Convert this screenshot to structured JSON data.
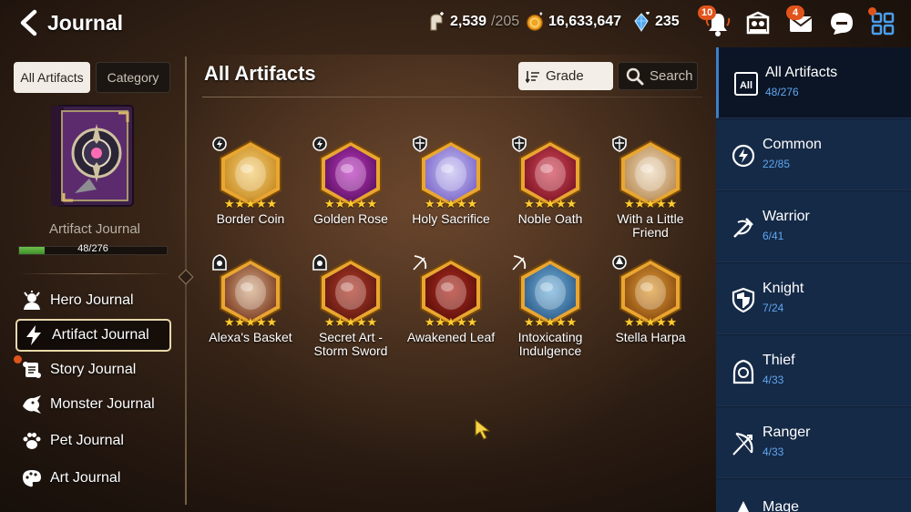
{
  "header": {
    "title": "Journal",
    "currencies": [
      {
        "icon": "stamina-icon",
        "value": "2,539",
        "sub": "/205"
      },
      {
        "icon": "gold-icon",
        "value": "16,633,647",
        "sub": ""
      },
      {
        "icon": "crystal-icon",
        "value": "235",
        "sub": ""
      }
    ],
    "notifications_badge": "10",
    "mail_badge": "4"
  },
  "left": {
    "tabs": {
      "active": "All Artifacts",
      "other": "Category"
    },
    "book_title": "Artifact Journal",
    "progress_text": "48/276",
    "progress_fraction": 0.174,
    "nav": [
      {
        "label": "Hero Journal",
        "icon": "hero-icon"
      },
      {
        "label": "Artifact Journal",
        "icon": "lightning-icon"
      },
      {
        "label": "Story Journal",
        "icon": "scroll-icon"
      },
      {
        "label": "Monster Journal",
        "icon": "dragon-icon"
      },
      {
        "label": "Pet Journal",
        "icon": "paw-icon"
      },
      {
        "label": "Art Journal",
        "icon": "palette-icon"
      }
    ]
  },
  "main": {
    "title": "All Artifacts",
    "grade_label": "Grade",
    "search_label": "Search",
    "artifacts": [
      {
        "name": "Border Coin",
        "class_icon": "common-icon",
        "stars": 5,
        "colors": [
          "#f6d27a",
          "#c78a22"
        ]
      },
      {
        "name": "Golden Rose",
        "class_icon": "common-icon",
        "stars": 5,
        "colors": [
          "#c23ac6",
          "#5a1160"
        ]
      },
      {
        "name": "Holy Sacrifice",
        "class_icon": "knight-icon",
        "stars": 5,
        "colors": [
          "#c9c4f4",
          "#7b66c9"
        ]
      },
      {
        "name": "Noble Oath",
        "class_icon": "knight-icon",
        "stars": 5,
        "colors": [
          "#d94b5c",
          "#7a1424"
        ]
      },
      {
        "name": "With a Little Friend",
        "class_icon": "knight-icon",
        "stars": 5,
        "colors": [
          "#efdcc0",
          "#b88b54"
        ]
      },
      {
        "name": "Alexa's Basket",
        "class_icon": "thief-icon",
        "stars": 5,
        "colors": [
          "#d8b08a",
          "#7a3a22"
        ]
      },
      {
        "name": "Secret Art - Storm Sword",
        "class_icon": "thief-icon",
        "stars": 5,
        "colors": [
          "#b63c2a",
          "#5e1810"
        ]
      },
      {
        "name": "Awakened Leaf",
        "class_icon": "ranger-icon",
        "stars": 5,
        "colors": [
          "#b42e22",
          "#5a0f0a"
        ]
      },
      {
        "name": "Intoxicating Indulgence",
        "class_icon": "ranger-icon",
        "stars": 5,
        "colors": [
          "#78b8e0",
          "#2c5a88"
        ]
      },
      {
        "name": "Stella Harpa",
        "class_icon": "mage-icon",
        "stars": 5,
        "colors": [
          "#e1a13b",
          "#8a4a10"
        ]
      }
    ]
  },
  "categories": [
    {
      "label": "All Artifacts",
      "count": "48/276",
      "icon": "all-icon"
    },
    {
      "label": "Common",
      "count": "22/85",
      "icon": "common-icon"
    },
    {
      "label": "Warrior",
      "count": "6/41",
      "icon": "warrior-icon"
    },
    {
      "label": "Knight",
      "count": "7/24",
      "icon": "knight-icon"
    },
    {
      "label": "Thief",
      "count": "4/33",
      "icon": "thief-icon"
    },
    {
      "label": "Ranger",
      "count": "4/33",
      "icon": "ranger-icon"
    },
    {
      "label": "Mage",
      "count": "",
      "icon": "mage-icon"
    }
  ],
  "colors": {
    "accent_blue": "#5fa6f0",
    "sidebar_bg": "#152a47",
    "star": "#ffcc33",
    "badge": "#e0541b"
  }
}
